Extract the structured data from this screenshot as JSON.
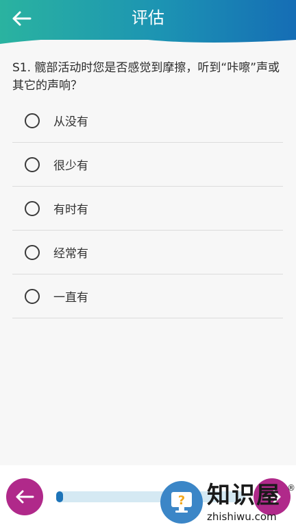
{
  "header": {
    "title": "评估",
    "back_icon": "arrow-left-icon"
  },
  "question": {
    "text": "S1. 髋部活动时您是否感觉到摩擦，听到“咔嚓”声或其它的声响？"
  },
  "options": [
    {
      "label": "从没有"
    },
    {
      "label": "很少有"
    },
    {
      "label": "有时有"
    },
    {
      "label": "经常有"
    },
    {
      "label": "一直有"
    }
  ],
  "footer": {
    "progress_fraction": 0.03,
    "accent_color": "#b0298a",
    "progress_color": "#1d74b8"
  },
  "watermark": {
    "text": "知识屋",
    "site": "zhishiwu.com",
    "reg": "®"
  }
}
